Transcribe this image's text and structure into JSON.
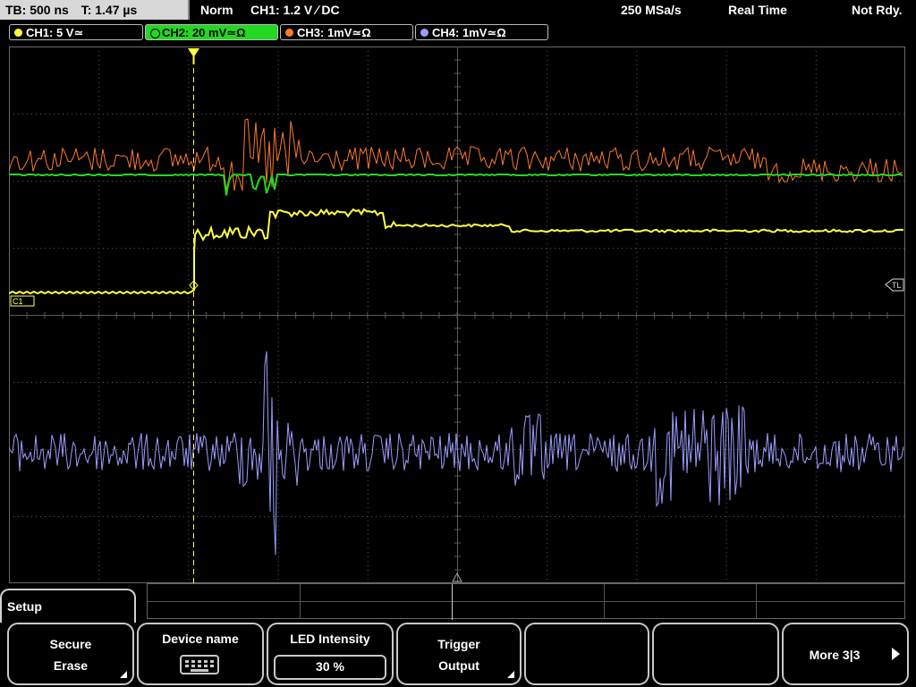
{
  "top_bar": {
    "timebase": "TB: 500 ns",
    "trigger_time": "T: 1.47 µs",
    "mode": "Norm",
    "trigger_setting": "CH1: 1.2 V ∕ DC",
    "sample_rate": "250 MSa/s",
    "acq_mode": "Real Time",
    "status": "Not Rdy."
  },
  "channels": [
    {
      "label": "CH1: 5 V≃",
      "color": "#ffff40",
      "active": false
    },
    {
      "label": "CH2: 20 mV≃Ω",
      "color": "#22d822",
      "active": true
    },
    {
      "label": "CH3: 1mV≃Ω",
      "color": "#ff7a28",
      "active": false
    },
    {
      "label": "CH4: 1mV≃Ω",
      "color": "#9c9cff",
      "active": false
    }
  ],
  "markers": {
    "trigger_level": "TL",
    "c1": "C1"
  },
  "menu": {
    "title": "Setup"
  },
  "softkeys": {
    "secure_erase": {
      "line1": "Secure",
      "line2": "Erase"
    },
    "device_name": {
      "label": "Device name"
    },
    "led_intensity": {
      "label": "LED Intensity",
      "value": "30 %"
    },
    "trigger_output": {
      "line1": "Trigger",
      "line2": "Output"
    },
    "more": {
      "label": "More 3|3"
    }
  },
  "colors": {
    "grid": "#5a5a5a",
    "trigger": "#ffff40"
  }
}
